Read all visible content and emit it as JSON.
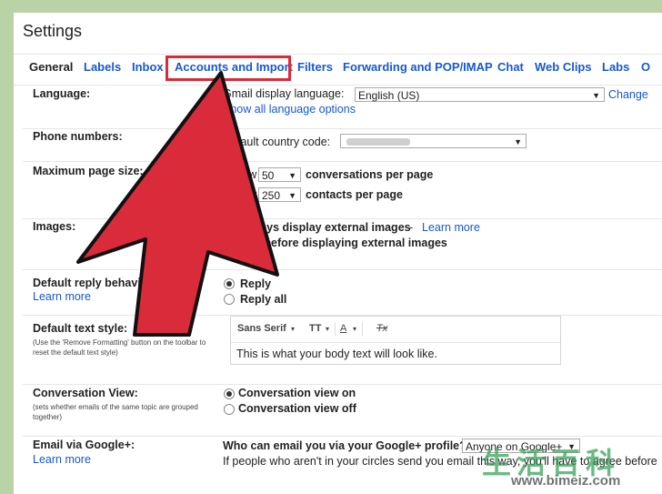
{
  "window": {
    "title": "Settings"
  },
  "tabs": [
    {
      "label": "General",
      "active": true
    },
    {
      "label": "Labels"
    },
    {
      "label": "Inbox"
    },
    {
      "label": "Accounts and Import",
      "highlighted": true
    },
    {
      "label": "Filters"
    },
    {
      "label": "Forwarding and POP/IMAP"
    },
    {
      "label": "Chat"
    },
    {
      "label": "Web Clips"
    },
    {
      "label": "Labs"
    },
    {
      "label": "O"
    }
  ],
  "language": {
    "label": "Language:",
    "display_label": "Gmail display language:",
    "display_value": "English (US)",
    "change_link": "Change",
    "show_all": "Show all language options"
  },
  "phone": {
    "label": "Phone numbers:",
    "country_label": "Default country code:",
    "country_value": ""
  },
  "page_size": {
    "label": "Maximum page size:",
    "show1": "Show",
    "conv_value": "50",
    "conv_text": "conversations per page",
    "show2": "Show",
    "contacts_value": "250",
    "contacts_text": "contacts per page"
  },
  "images": {
    "label": "Images:",
    "opt1": "Always display external images",
    "opt1_sep": " - ",
    "learn": "Learn more",
    "opt2": "Ask before displaying external images"
  },
  "reply": {
    "label": "Default reply behavior:",
    "learn": "Learn more",
    "opt1": "Reply",
    "opt2": "Reply all"
  },
  "text_style": {
    "label": "Default text style:",
    "sub": "(Use the 'Remove Formatting' button on the toolbar to reset the default text style)",
    "font": "Sans Serif",
    "size_icon": "TT",
    "color_icon": "A",
    "clear_icon": "Tx",
    "preview": "This is what your body text will look like."
  },
  "conversation": {
    "label": "Conversation View:",
    "sub": "(sets whether emails of the same topic are grouped together)",
    "opt_on": "Conversation view on",
    "opt_off": "Conversation view off"
  },
  "gplus": {
    "label": "Email via Google+:",
    "learn": "Learn more",
    "question": "Who can email you via your Google+ profile?",
    "value": "Anyone on Google+",
    "note": "If people who aren't in your circles send you email this way, you'll have to agree before"
  },
  "watermark": {
    "line1": "生活百科",
    "line2": "www.bimeiz.com"
  },
  "colors": {
    "link": "#1558d6",
    "arrow": "#d92b3a",
    "highlight": "#d92b3a",
    "background": "#b9d3a6"
  }
}
